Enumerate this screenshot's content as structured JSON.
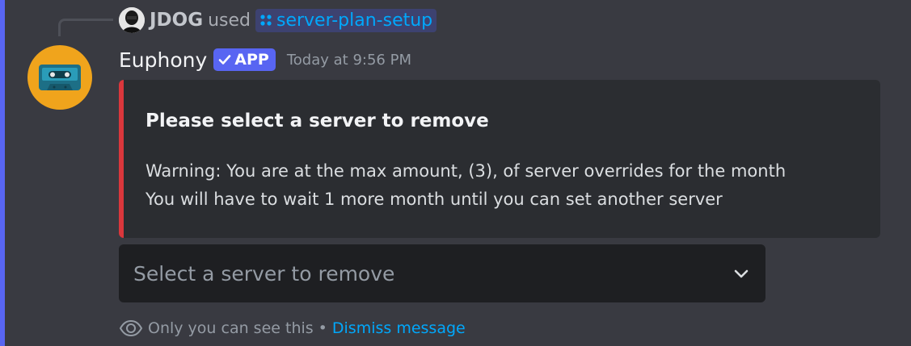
{
  "reply": {
    "username": "JDOG",
    "verb": "used",
    "command": "server-plan-setup",
    "command_icon": "app-command-icon",
    "avatar_icon": "user-avatar"
  },
  "message": {
    "bot_name": "Euphony",
    "badge_label": "APP",
    "badge_icon": "checkmark-icon",
    "timestamp": "Today at 9:56 PM",
    "avatar_icon": "cassette-tape-icon"
  },
  "embed": {
    "title": "Please select a server to remove",
    "description_lines": [
      "Warning: You are at the max amount, (3), of server overrides for the month",
      "You will have to wait 1 more month until you can set another server"
    ],
    "accent_color": "#da373c"
  },
  "select": {
    "placeholder": "Select a server to remove",
    "icon": "chevron-down-icon"
  },
  "footer": {
    "note": "Only you can see this",
    "separator": "•",
    "dismiss_label": "Dismiss message",
    "icon": "eye-icon"
  },
  "colors": {
    "background": "#393a41",
    "brand": "#5865f2",
    "link": "#00a8fc",
    "avatar_bg": "#f0a41c"
  }
}
